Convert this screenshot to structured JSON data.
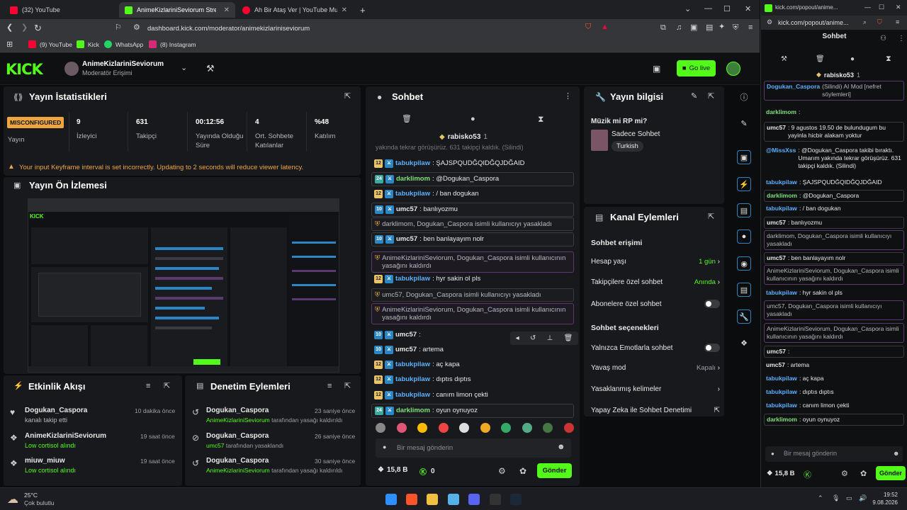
{
  "browser": {
    "tabs": [
      {
        "title": "(32) YouTube"
      },
      {
        "title": "AnimeKizlariniSeviorum Stream"
      },
      {
        "title": "Ah Bir Ataş Ver | YouTube Music"
      }
    ],
    "new_tab": "+",
    "url": "dashboard.kick.com/moderator/animekizlariniseviorum",
    "bookmarks": [
      "(9) YouTube",
      "Kick",
      "WhatsApp",
      "(8) Instagram"
    ]
  },
  "header": {
    "logo": "KICK",
    "channel_name": "AnimeKizlariniSeviorum",
    "role": "Moderatör Erişimi",
    "go_live": "Go live"
  },
  "stats": {
    "title": "Yayın İstatistikleri",
    "status_badge": "MISCONFIGURED",
    "status_label": "Yayın",
    "items": [
      {
        "value": "9",
        "label": "İzleyici"
      },
      {
        "value": "631",
        "label": "Takipçi"
      },
      {
        "value": "00:12:56",
        "label": "Yayında Olduğu Süre"
      },
      {
        "value": "4",
        "label": "Ort. Sohbete Katılanlar"
      },
      {
        "value": "%48",
        "label": "Katılım"
      }
    ],
    "warning": "Your input Keyframe interval is set incorrectly. Updating to 2 seconds will reduce viewer latency."
  },
  "preview": {
    "title": "Yayın Ön İzlemesi"
  },
  "activity": {
    "title": "Etkinlik Akışı",
    "items": [
      {
        "user": "Dogukan_Caspora",
        "desc": "kanalı takip etti",
        "time": "10 dakika önce"
      },
      {
        "user": "AnimeKizlariniSeviorum",
        "desc": "Low cortisol alındı",
        "time": "19 saat önce"
      },
      {
        "user": "miuw_miuw",
        "desc": "Low cortisol alındı",
        "time": "19 saat önce"
      }
    ]
  },
  "moderation": {
    "title": "Denetim Eylemleri",
    "items": [
      {
        "user": "Dogukan_Caspora",
        "by": "AnimeKizlariniSeviorum",
        "desc": "tarafından yasağı kaldırıldı",
        "time": "23 saniye önce"
      },
      {
        "user": "Dogukan_Caspora",
        "by": "umc57",
        "desc": "tarafından yasaklandı",
        "time": "26 saniye önce"
      },
      {
        "user": "Dogukan_Caspora",
        "by": "AnimeKizlariniSeviorum",
        "desc": "tarafından yasağı kaldırıldı",
        "time": "30 saniye önce"
      }
    ]
  },
  "chat": {
    "title": "Sohbet",
    "pinned_user": "rabisko53",
    "pinned_count": "1",
    "top_partial": "yakında tekrar görüşürüz. 631 takipçi kaldık. (Silindi)",
    "messages": [
      {
        "badge": "12",
        "user": "tabukpilaw",
        "text": ": ŞAJSPQUDĞQIDĞQJDĞAID",
        "style": ""
      },
      {
        "badge": "24",
        "user": "darklimom",
        "text": ": @Dogukan_Caspora",
        "style": "hl"
      },
      {
        "badge": "12",
        "user": "tabukpilaw",
        "text": ": / ban dogukan",
        "style": ""
      },
      {
        "badge": "10",
        "user": "umc57",
        "text": ": banlıyozmu",
        "style": "hl"
      },
      {
        "badge": "",
        "user": "",
        "text": "darklimom, Dogukan_Caspora isimli kullanıcıyı yasakladı",
        "style": "sysg"
      },
      {
        "badge": "10",
        "user": "umc57",
        "text": ": ben banlayayım nolr",
        "style": "hl"
      },
      {
        "badge": "",
        "user": "",
        "text": "AnimeKizlariniSeviorum, Dogukan_Caspora isimli kullanıcının yasağını kaldırdı",
        "style": "sys"
      },
      {
        "badge": "12",
        "user": "tabukpilaw",
        "text": ": hyr sakin ol pls",
        "style": ""
      },
      {
        "badge": "",
        "user": "",
        "text": "umc57, Dogukan_Caspora isimli kullanıcıyı yasakladı",
        "style": "sysg"
      },
      {
        "badge": "",
        "user": "",
        "text": "AnimeKizlariniSeviorum, Dogukan_Caspora isimli kullanıcının yasağını kaldırdı",
        "style": "sys"
      },
      {
        "badge": "10",
        "user": "umc57",
        "text": ":",
        "style": ""
      },
      {
        "badge": "10",
        "user": "umc57",
        "text": ": artema",
        "style": ""
      },
      {
        "badge": "12",
        "user": "tabukpilaw",
        "text": ": aç kapa",
        "style": ""
      },
      {
        "badge": "12",
        "user": "tabukpilaw",
        "text": ": dıptıs dıptıs",
        "style": ""
      },
      {
        "badge": "12",
        "user": "tabukpilaw",
        "text": ": canım limon çekti",
        "style": ""
      },
      {
        "badge": "24",
        "user": "darklimom",
        "text": ": oyun oynuyoz",
        "style": "hl"
      }
    ],
    "input_placeholder": "Bir mesaj gönderin",
    "points": "15,8 B",
    "kicks": "0",
    "send": "Gönder"
  },
  "stream_info": {
    "title": "Yayın bilgisi",
    "stream_title": "Müzik mi RP mi?",
    "category": "Sadece Sohbet",
    "tag": "Turkish"
  },
  "channel_actions": {
    "title": "Kanal Eylemleri",
    "chat_access": "Sohbet erişimi",
    "rows1": [
      {
        "label": "Hesap yaşı",
        "value": "1 gün"
      },
      {
        "label": "Takipçilere özel sohbet",
        "value": "Anında"
      },
      {
        "label": "Abonelere özel sohbet",
        "value": ""
      }
    ],
    "chat_options": "Sohbet seçenekleri",
    "rows2": [
      {
        "label": "Yalnızca Emotlarla sohbet",
        "value": ""
      },
      {
        "label": "Yavaş mod",
        "value": "Kapalı"
      },
      {
        "label": "Yasaklanmış kelimeler",
        "value": ""
      },
      {
        "label": "Yapay Zeka ile Sohbet Denetimi",
        "value": ""
      }
    ]
  },
  "popout": {
    "url": "kick.com/popout/anime...",
    "title": "Sohbet",
    "pinned_user": "rabisko53",
    "pinned_count": "1",
    "messages": [
      {
        "user": "Dogukan_Caspora",
        "text": "(Silindi) AI Mod [nefret söylemleri]",
        "style": "sys"
      },
      {
        "user": "darklimom",
        "text": ":",
        "style": ""
      },
      {
        "user": "umc57",
        "text": ": 9 agustos 19.50 de bulundugum bu yayinla hicbir alakam yoktur",
        "style": "hl"
      },
      {
        "user": "@MissXss",
        "text": ": @Dogukan_Caspora takibi bıraktı. Umarım yakında tekrar görüşürüz. 631 takipçi kaldık. (Silindi)",
        "style": ""
      },
      {
        "user": "tabukpilaw",
        "text": ": ŞAJSPQUDĞQIDĞQJDĞAID",
        "style": ""
      },
      {
        "user": "darklimom",
        "text": ": @Dogukan_Caspora",
        "style": "hl"
      },
      {
        "user": "tabukpilaw",
        "text": ": / ban dogukan",
        "style": ""
      },
      {
        "user": "umc57",
        "text": ": banlıyozmu",
        "style": "hl"
      },
      {
        "user": "",
        "text": "darklimom, Dogukan_Caspora isimli kullanıcıyı yasakladı",
        "style": "sys"
      },
      {
        "user": "umc57",
        "text": ": ben banlayayım nolr",
        "style": "hl"
      },
      {
        "user": "",
        "text": "AnimeKizlariniSeviorum, Dogukan_Caspora isimli kullanıcının yasağını kaldırdı",
        "style": "sys"
      },
      {
        "user": "tabukpilaw",
        "text": ": hyr sakin ol pls",
        "style": ""
      },
      {
        "user": "",
        "text": "umc57, Dogukan_Caspora isimli kullanıcıyı yasakladı",
        "style": "sys"
      },
      {
        "user": "",
        "text": "AnimeKizlariniSeviorum, Dogukan_Caspora isimli kullanıcının yasağını kaldırdı",
        "style": "sys"
      },
      {
        "user": "umc57",
        "text": ":",
        "style": "hl"
      },
      {
        "user": "umc57",
        "text": ": artema",
        "style": ""
      },
      {
        "user": "tabukpilaw",
        "text": ": aç kapa",
        "style": ""
      },
      {
        "user": "tabukpilaw",
        "text": ": dıptıs dıptıs",
        "style": ""
      },
      {
        "user": "tabukpilaw",
        "text": ": canım limon çekti",
        "style": ""
      },
      {
        "user": "darklimom",
        "text": ": oyun oynuyoz",
        "style": "hl"
      }
    ],
    "input_placeholder": "Bir mesaj gönderin",
    "points": "15,8 B",
    "send": "Gönder"
  },
  "taskbar": {
    "weather_temp": "25°C",
    "weather_desc": "Çok bulutlu",
    "time": "19:52",
    "date": "9.08.2026"
  },
  "colors": {
    "accent": "#53fc18",
    "bg": "#0b0c0e",
    "panel": "#18191c"
  }
}
